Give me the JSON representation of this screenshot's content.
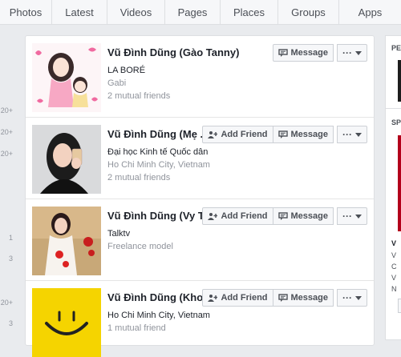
{
  "tabs": [
    "Photos",
    "Latest",
    "Videos",
    "Pages",
    "Places",
    "Groups",
    "Apps"
  ],
  "gutter": [
    "20+",
    "20+",
    "20+",
    "1",
    "3",
    "20+",
    "3"
  ],
  "results": [
    {
      "name": "Vũ Đình Dũng (Gào Tanny)",
      "line1": "LA BORÉ",
      "line2": "Gabi",
      "line3": "2 mutual friends",
      "show_add": false,
      "message_label": "Message",
      "more_label": "···"
    },
    {
      "name": "Vũ Đình Dũng (Mẹ ...",
      "line1": "Đại học Kinh tế Quốc dân",
      "line2": "Ho Chi Minh City, Vietnam",
      "line3": "2 mutual friends",
      "show_add": true,
      "add_label": "Add Friend",
      "message_label": "Message",
      "more_label": "···"
    },
    {
      "name": "Vũ Đình Dũng (Vy T...",
      "line1": "Talktv",
      "line2": "Freelance model",
      "line3": "",
      "show_add": true,
      "add_label": "Add Friend",
      "message_label": "Message",
      "more_label": "···"
    },
    {
      "name": "Vũ Đình Dũng (Kho...",
      "line1": "Ho Chi Minh City, Vietnam",
      "line2": "1 mutual friend",
      "line3": "",
      "show_add": true,
      "add_label": "Add Friend",
      "message_label": "Message",
      "more_label": "···"
    }
  ],
  "sidebar": {
    "heading1": "PE",
    "heading2": "SP",
    "letters": [
      "V",
      "V",
      "C",
      "V",
      "N"
    ]
  },
  "colors": {
    "accent": "#4b4f56",
    "muted": "#90949c",
    "background": "#e9ebee",
    "sidebar_red": "#b3001b"
  }
}
